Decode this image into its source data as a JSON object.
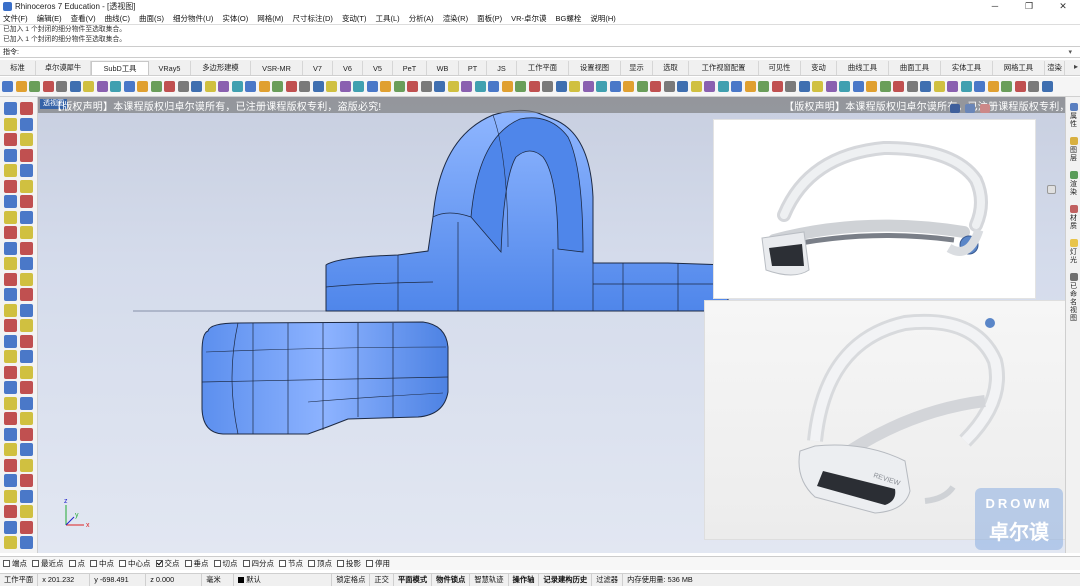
{
  "window": {
    "title": "Rhinoceros 7 Education - [透视图]",
    "minimize": "─",
    "restore": "❐",
    "close": "✕"
  },
  "menubar": [
    "文件(F)",
    "编辑(E)",
    "查看(V)",
    "曲线(C)",
    "曲面(S)",
    "细分物件(U)",
    "实体(O)",
    "网格(M)",
    "尺寸标注(D)",
    "变动(T)",
    "工具(L)",
    "分析(A)",
    "渲染(R)",
    "面板(P)",
    "VR-卓尔谟",
    "BG螺栓",
    "说明(H)"
  ],
  "command_history": [
    "已加入 1 个封闭的细分物件至选取集合。",
    "已加入 1 个封闭的细分物件至选取集合。"
  ],
  "command_prompt": "指令:",
  "command_value": "",
  "tabs": [
    "标准",
    "卓尔谟犀牛",
    "SubD工具",
    "VRay5",
    "多边形建模",
    "VSR-MR",
    "V7",
    "V6",
    "V5",
    "PeT",
    "WB",
    "PT",
    "JS",
    "工作平面",
    "设置视图",
    "显示",
    "选取",
    "工作视窗配置",
    "可见性",
    "变动",
    "曲线工具",
    "曲面工具",
    "实体工具",
    "网格工具",
    "渲染"
  ],
  "active_tab": "SubD工具",
  "viewport": {
    "label": "透视图",
    "copyright_left": "【版权声明】本课程版权归卓尔谟所有，已注册课程版权专利，盗版必究!",
    "copyright_right": "【版权声明】本课程版权归卓尔谟所有，已注册课程版权专利，盗版必究!",
    "axis_x": "x",
    "axis_y": "y",
    "axis_z": "z",
    "ref_brand": "REVIEW"
  },
  "watermark": {
    "line1": "DROWM",
    "line2": "卓尔谟"
  },
  "right_panel": [
    "属性",
    "图层",
    "渲染",
    "材质",
    "灯光",
    "已命名视图"
  ],
  "osnaps": [
    {
      "label": "端点",
      "checked": false
    },
    {
      "label": "最近点",
      "checked": false
    },
    {
      "label": "点",
      "checked": false
    },
    {
      "label": "中点",
      "checked": false
    },
    {
      "label": "中心点",
      "checked": false
    },
    {
      "label": "交点",
      "checked": true
    },
    {
      "label": "垂点",
      "checked": false
    },
    {
      "label": "切点",
      "checked": false
    },
    {
      "label": "四分点",
      "checked": false
    },
    {
      "label": "节点",
      "checked": false
    },
    {
      "label": "顶点",
      "checked": false
    },
    {
      "label": "投影",
      "checked": false
    },
    {
      "label": "停用",
      "checked": false
    }
  ],
  "status": {
    "cplane": "工作平面",
    "x": "x 201.232",
    "y": "y -698.491",
    "z": "z 0.000",
    "units": "毫米",
    "layer": "默认",
    "toggles": [
      "锁定格点",
      "正交",
      "平面模式",
      "物件锁点",
      "智慧轨迹",
      "操作轴",
      "记录建构历史",
      "过滤器"
    ],
    "memory": "内存使用量: 536 MB"
  },
  "colors": {
    "model_blue": "#6b9cf2",
    "viewport_bg": "#d4dbeb",
    "header_bar": "#7a7a7a"
  }
}
